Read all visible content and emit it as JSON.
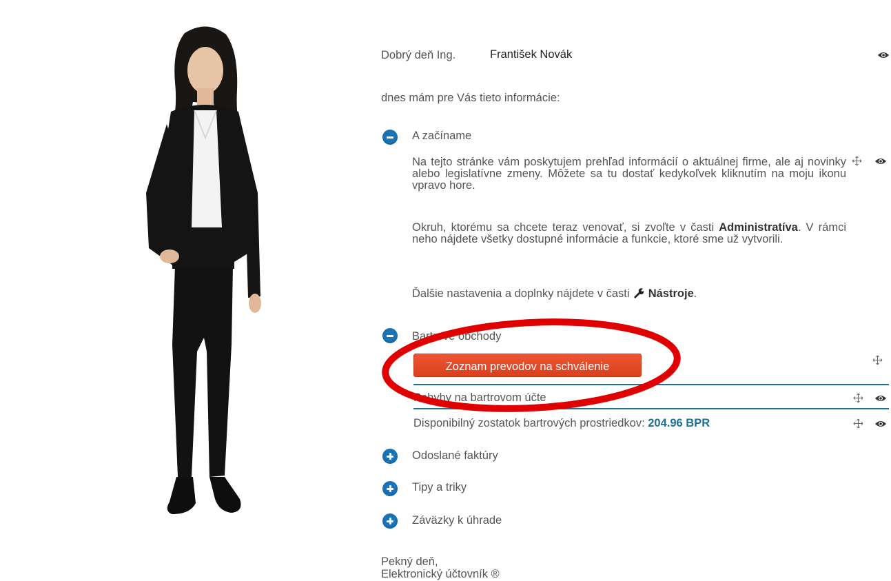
{
  "greeting": {
    "prefix": "Dobrý deň Ing.",
    "name": "František Novák"
  },
  "intro": "dnes mám pre Vás tieto informácie:",
  "sections": [
    {
      "title": "A začíname",
      "expanded": true,
      "p1": "Na tejto stránke vám poskytujem prehľad informácií o aktuálnej firme, ale aj novinky alebo legislatívne zmeny. Môžete sa tu dostať kedykoľvek kliknutím na moju ikonu vpravo hore.",
      "p2_before": "Okruh, ktorému sa chcete teraz venovať, si zvoľte v časti",
      "p2_bold": "Administratíva",
      "p2_after": ". V rámci neho nájdete všetky dostupné informácie a funkcie, ktoré sme už vytvorili.",
      "p3_before": "Ďalšie nastavenia a doplnky nájdete v časti",
      "p3_bold": "Nástroje",
      "p3_after": "."
    },
    {
      "title": "Bartrové obchody",
      "expanded": true,
      "button_label": "Zoznam prevodov na schválenie",
      "row1": "Pohyby na bartrovom účte",
      "row2_label": "Disponibilný zostatok bartrových prostriedkov:",
      "row2_value": "204.96 BPR"
    },
    {
      "title": "Odoslané faktúry",
      "expanded": false
    },
    {
      "title": "Tipy a triky",
      "expanded": false
    },
    {
      "title": "Záväzky k úhrade",
      "expanded": false
    }
  ],
  "signoff": {
    "line1": "Pekný deň,",
    "line2": "Elektronický účtovník ®"
  },
  "colors": {
    "toggle": "#1a73b7",
    "button": "#e04a27",
    "accent": "#1e6f92",
    "highlight_ring": "#e00000"
  },
  "icons": [
    "eye-icon",
    "move-icon",
    "minus-icon",
    "plus-icon",
    "wrench-icon",
    "assistant-photo"
  ]
}
